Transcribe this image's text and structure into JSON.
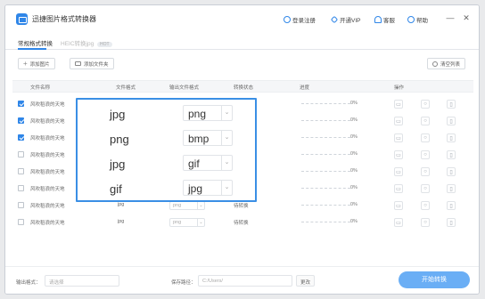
{
  "app": {
    "title": "迅捷图片格式转换器",
    "login": "登录注册",
    "vip": "开通VIP",
    "service": "客服",
    "help": "帮助",
    "minimize": "—",
    "close": "✕"
  },
  "tabs": [
    {
      "label": "常规格式转换",
      "active": true
    },
    {
      "label": "HEIC转换jpg",
      "badge": "HOT",
      "active": false
    }
  ],
  "toolbar": {
    "add_image": "添加图片",
    "add_folder": "添加文件夹",
    "clear_list": "清空列表"
  },
  "table": {
    "headers": [
      "文件名称",
      "文件格式",
      "输出文件格式",
      "转换状态",
      "进度",
      "操作"
    ],
    "rows": [
      {
        "name": "风吹稻浪的天地",
        "format": "jpg",
        "output": "png",
        "status": "待转换",
        "progress": "0%",
        "checked": true
      },
      {
        "name": "风吹稻浪的天地",
        "format": "png",
        "output": "bmp",
        "status": "待转换",
        "progress": "0%",
        "checked": true
      },
      {
        "name": "风吹稻浪的天地",
        "format": "jpg",
        "output": "gif",
        "status": "待转换",
        "progress": "0%",
        "checked": true
      },
      {
        "name": "风吹稻浪的天地",
        "format": "gif",
        "output": "jpg",
        "status": "待转换",
        "progress": "0%",
        "checked": false
      },
      {
        "name": "风吹稻浪的天地",
        "format": "jpg",
        "output": "png",
        "status": "待转换",
        "progress": "0%",
        "checked": false
      },
      {
        "name": "风吹稻浪的天地",
        "format": "jpg",
        "output": "png",
        "status": "待转换",
        "progress": "0%",
        "checked": false
      },
      {
        "name": "风吹稻浪的天地",
        "format": "jpg",
        "output": "png",
        "status": "待转换",
        "progress": "0%",
        "checked": false
      },
      {
        "name": "风吹稻浪的天地",
        "format": "jpg",
        "output": "png",
        "status": "待转换",
        "progress": "0%",
        "checked": false
      }
    ]
  },
  "highlight": [
    {
      "format": "jpg",
      "output": "png",
      "arrow": "⌄"
    },
    {
      "format": "png",
      "output": "bmp",
      "arrow": "⌄"
    },
    {
      "format": "jpg",
      "output": "gif",
      "arrow": "⌄"
    },
    {
      "format": "gif",
      "output": "jpg",
      "arrow": "⌄"
    }
  ],
  "bottom": {
    "output_format_label": "输出格式：",
    "output_format_value": "请选择",
    "save_path_label": "保存路径：",
    "save_path_value": "C:/Users/",
    "change_label": "更改",
    "start_label": "开始转换"
  },
  "colors": {
    "accent": "#2f86e8",
    "highlight_border": "#3a8fe5",
    "start_button": "#6aaef5"
  }
}
